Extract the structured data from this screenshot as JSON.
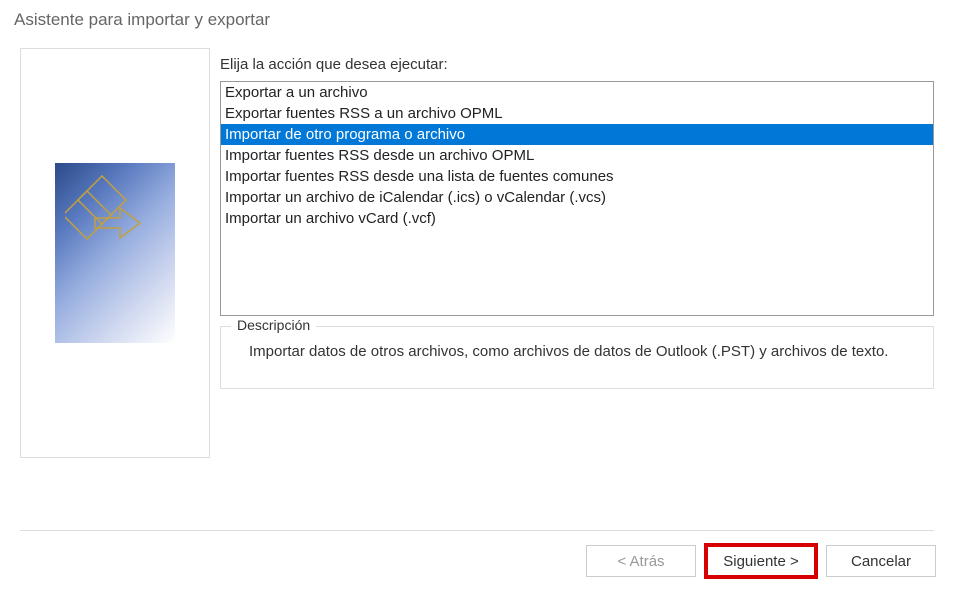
{
  "window": {
    "title": "Asistente para importar y exportar"
  },
  "main": {
    "prompt": "Elija la acción que desea ejecutar:",
    "actions": [
      {
        "label": "Exportar a un archivo",
        "selected": false
      },
      {
        "label": "Exportar fuentes RSS a un archivo OPML",
        "selected": false
      },
      {
        "label": "Importar de otro programa o archivo",
        "selected": true
      },
      {
        "label": "Importar fuentes RSS desde un archivo OPML",
        "selected": false
      },
      {
        "label": "Importar fuentes RSS desde una lista de fuentes comunes",
        "selected": false
      },
      {
        "label": "Importar un archivo de iCalendar (.ics) o vCalendar (.vcs)",
        "selected": false
      },
      {
        "label": "Importar un archivo vCard (.vcf)",
        "selected": false
      }
    ],
    "description_label": "Descripción",
    "description_text": "Importar datos de otros archivos, como archivos de datos de Outlook (.PST) y archivos de texto."
  },
  "footer": {
    "back": "< Atrás",
    "next": "Siguiente >",
    "cancel": "Cancelar"
  }
}
